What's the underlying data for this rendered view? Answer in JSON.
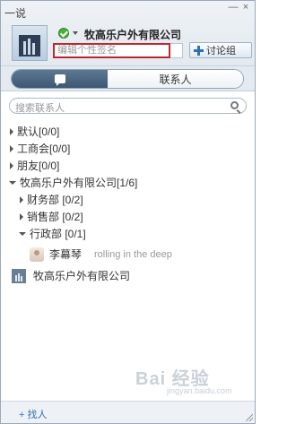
{
  "window": {
    "title": "一说",
    "minimize_glyph": "—",
    "close_glyph": "×"
  },
  "profile": {
    "name": "牧高乐户外有限公司",
    "signature_placeholder": "编辑个性签名",
    "status_icon": "online-check-icon"
  },
  "toolbar": {
    "create_group_label": "讨论组"
  },
  "tabs": {
    "chat_icon": "chat-bubble-icon",
    "contacts_label": "联系人"
  },
  "search": {
    "placeholder": "搜索联系人"
  },
  "groups": {
    "default": "默认[0/0]",
    "union": "工商会[0/0]",
    "friends": "朋友[0/0]",
    "company": "牧高乐户外有限公司[1/6]",
    "finance": "财务部 [0/2]",
    "sales": "销售部 [0/2]",
    "admin": "行政部 [0/1]"
  },
  "contact": {
    "name": "李幕琴",
    "signature": "rolling in the deep"
  },
  "org_entry": {
    "name": "牧高乐户外有限公司"
  },
  "watermark": {
    "text": "Bai 经验",
    "url": "jingyan.baidu.com"
  },
  "footer": {
    "add_label": "+ 找人"
  },
  "colors": {
    "accent": "#2f6fb3",
    "highlight_border": "#c0262d",
    "online": "#4cae3b"
  }
}
